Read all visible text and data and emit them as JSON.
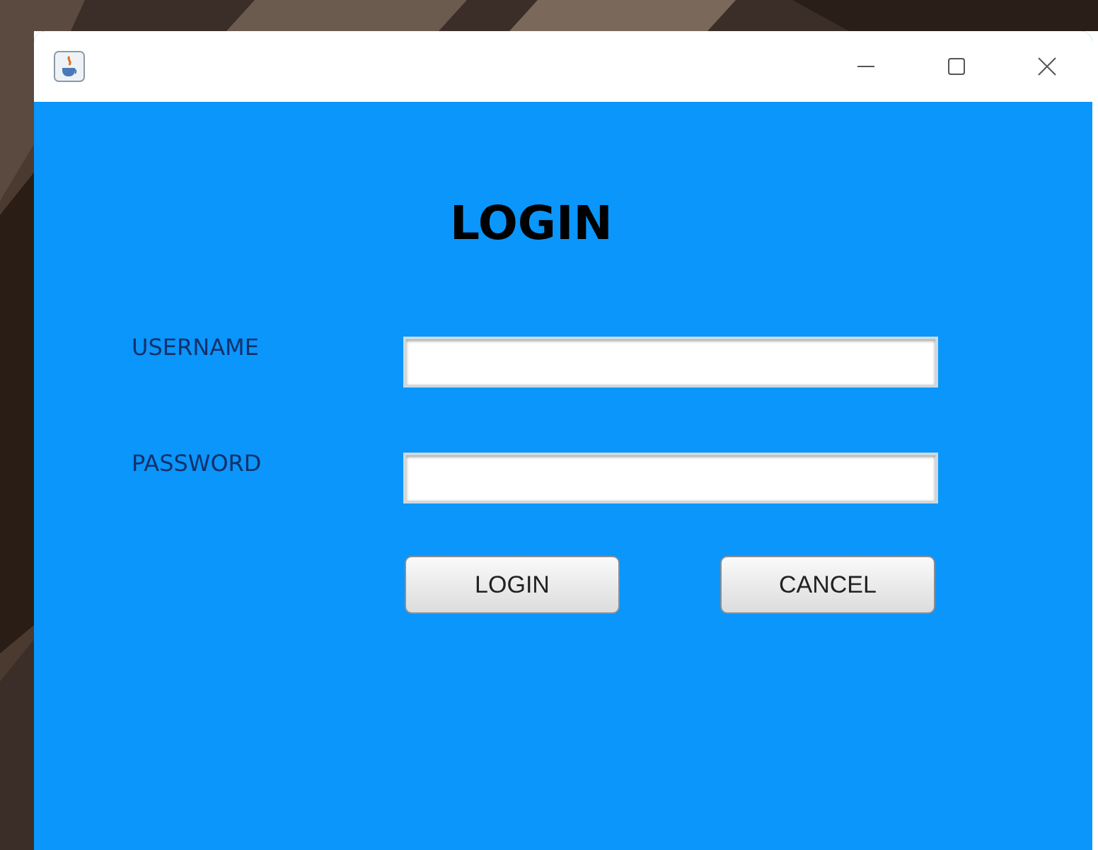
{
  "window": {
    "title_bar": {
      "buttons": [
        {
          "kind": "minimize"
        },
        {
          "kind": "maximize"
        },
        {
          "kind": "close"
        }
      ]
    }
  },
  "heading": "LOGIN",
  "fields": [
    {
      "label": "USERNAME"
    },
    {
      "label": "PASSWORD"
    }
  ],
  "buttons": [
    "LOGIN",
    "CANCEL"
  ]
}
